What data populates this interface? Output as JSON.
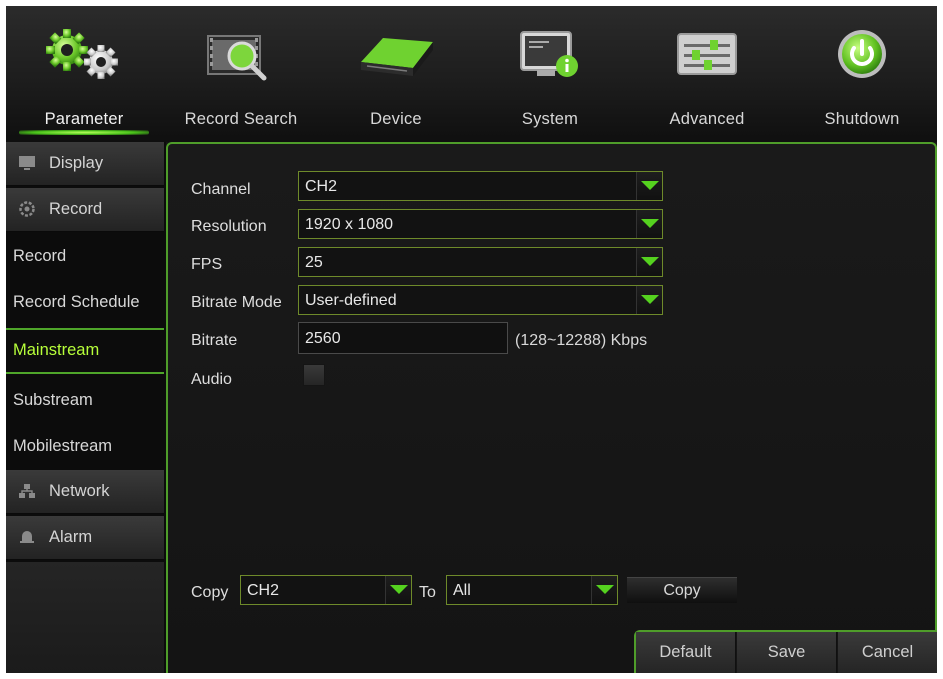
{
  "nav": {
    "items": [
      {
        "label": "Parameter",
        "icon": "gears-icon"
      },
      {
        "label": "Record Search",
        "icon": "film-search-icon"
      },
      {
        "label": "Device",
        "icon": "hard-drive-icon"
      },
      {
        "label": "System",
        "icon": "monitor-info-icon"
      },
      {
        "label": "Advanced",
        "icon": "sliders-icon"
      },
      {
        "label": "Shutdown",
        "icon": "power-icon"
      }
    ],
    "active": "Parameter"
  },
  "sidebar": {
    "categories": {
      "display": {
        "label": "Display",
        "icon": "display-icon"
      },
      "record": {
        "label": "Record",
        "icon": "record-gear-icon"
      },
      "network": {
        "label": "Network",
        "icon": "network-icon"
      },
      "alarm": {
        "label": "Alarm",
        "icon": "alarm-bell-icon"
      }
    },
    "record_items": [
      "Record",
      "Record Schedule",
      "Mainstream",
      "Substream",
      "Mobilestream"
    ],
    "active_item": "Mainstream"
  },
  "form": {
    "channel": {
      "label": "Channel",
      "value": "CH2"
    },
    "resolution": {
      "label": "Resolution",
      "value": "1920 x 1080"
    },
    "fps": {
      "label": "FPS",
      "value": "25"
    },
    "bitrate_mode": {
      "label": "Bitrate Mode",
      "value": "User-defined"
    },
    "bitrate": {
      "label": "Bitrate",
      "value": "2560",
      "hint": "(128~12288) Kbps"
    },
    "audio": {
      "label": "Audio",
      "checked": false
    }
  },
  "copy": {
    "label": "Copy",
    "from_value": "CH2",
    "to_label": "To",
    "to_value": "All",
    "button_label": "Copy"
  },
  "buttons": {
    "default": "Default",
    "save": "Save",
    "cancel": "Cancel"
  },
  "colors": {
    "accent_green": "#55d21f",
    "active_text": "#b7ff3a",
    "border_green": "#4f9d2a"
  }
}
